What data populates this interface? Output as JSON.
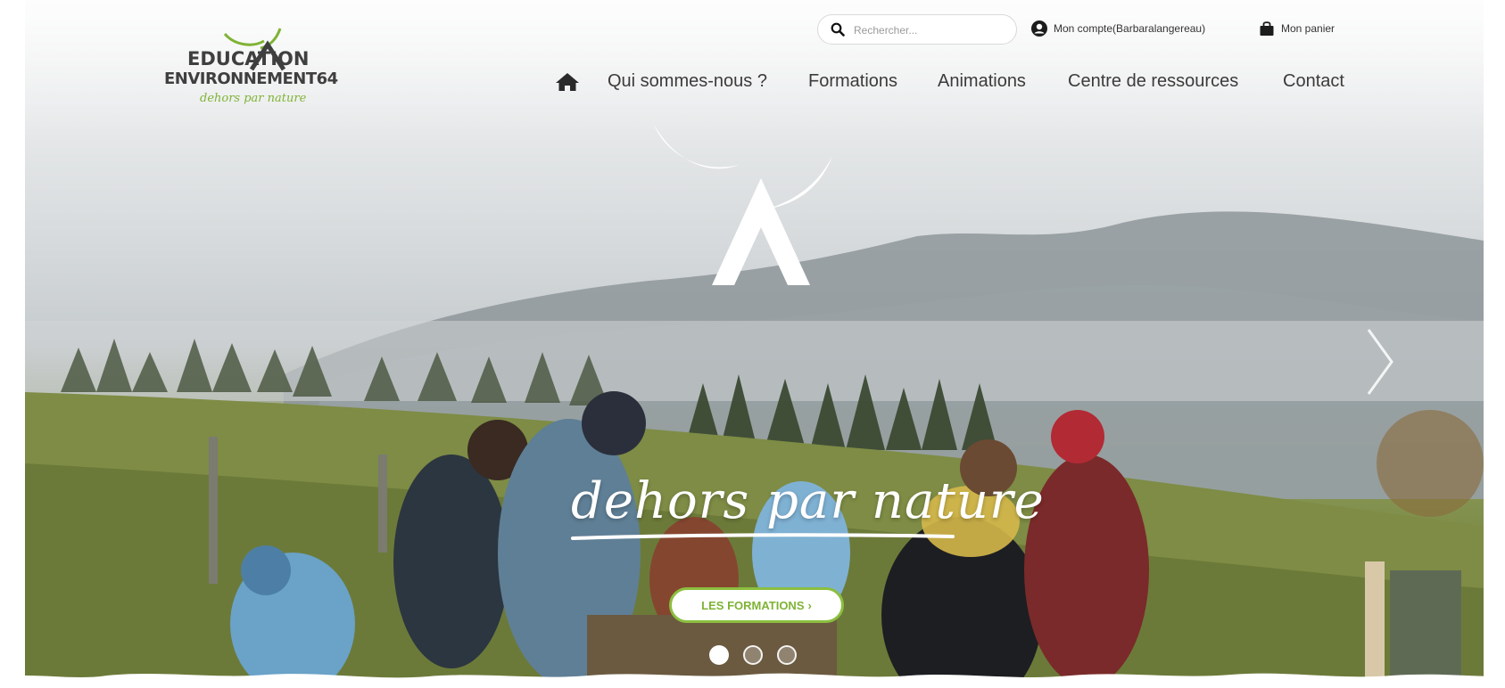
{
  "logo": {
    "line1": "EDUCATION",
    "line2": "ENVIRONNEMENT64",
    "tagline": "dehors par nature",
    "colors": {
      "dark": "#3f3f3f",
      "green": "#7fb335"
    }
  },
  "header": {
    "search": {
      "placeholder": "Rechercher...",
      "icon": "search-icon"
    },
    "account": {
      "label": "Mon compte(Barbaralangereau)",
      "icon": "user-circle-icon"
    },
    "cart": {
      "label": "Mon panier",
      "icon": "shopping-bag-icon"
    }
  },
  "nav": {
    "home_icon": "home-icon",
    "items": [
      {
        "label": "Qui sommes-nous ?"
      },
      {
        "label": "Formations"
      },
      {
        "label": "Animations"
      },
      {
        "label": "Centre de ressources"
      },
      {
        "label": "Contact"
      }
    ]
  },
  "hero": {
    "headline": "dehors par nature",
    "cta_label": "LES FORMATIONS",
    "cta_arrow": "›",
    "next_icon": "chevron-right-icon",
    "slides_total": 3,
    "active_slide": 1,
    "accent": "#8bbf3f"
  }
}
